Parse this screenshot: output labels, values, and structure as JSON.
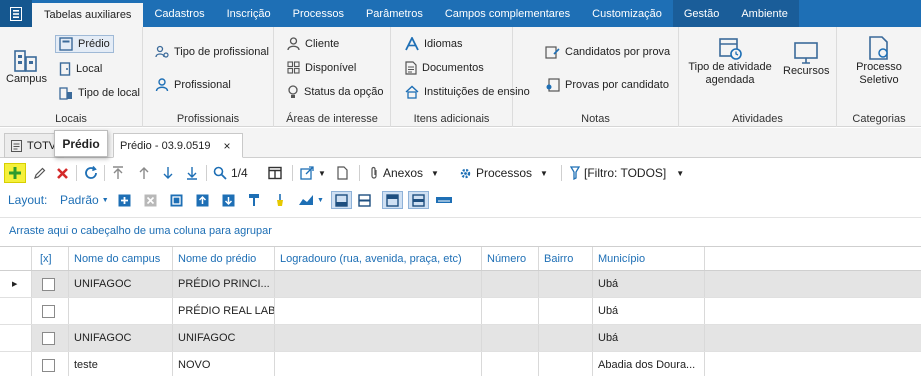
{
  "tabs": {
    "items": [
      "Tabelas auxiliares",
      "Cadastros",
      "Inscrição",
      "Processos",
      "Parâmetros",
      "Campos complementares",
      "Customização",
      "Gestão",
      "Ambiente"
    ]
  },
  "ribbon": {
    "locais": {
      "label": "Locais",
      "campus": "Campus",
      "predio": "Prédio",
      "local": "Local",
      "tipo_local": "Tipo de local"
    },
    "profissionais": {
      "label": "Profissionais",
      "tipo_profissional": "Tipo de profissional",
      "profissional": "Profissional"
    },
    "areas": {
      "label": "Áreas de interesse",
      "cliente": "Cliente",
      "disponivel": "Disponível",
      "status_opcao": "Status da opção"
    },
    "itens": {
      "label": "Itens adicionais",
      "idiomas": "Idiomas",
      "documentos": "Documentos",
      "instituicoes": "Instituições de ensino"
    },
    "notas": {
      "label": "Notas",
      "candidatos_prova": "Candidatos por prova",
      "provas_candidato": "Provas por candidato"
    },
    "atividades": {
      "label": "Atividades",
      "tipo_atividade": "Tipo de atividade agendada",
      "recursos": "Recursos"
    },
    "categorias": {
      "label": "Categorias",
      "processo_seletivo": "Processo Seletivo"
    }
  },
  "doctabs": {
    "first": "TOTV",
    "active": "Prédio - 03.9.0519",
    "close": "×",
    "tooltip": "Prédio"
  },
  "toolbar": {
    "page": "1/4",
    "anexos": "Anexos",
    "processos": "Processos",
    "filtro": "[Filtro: TODOS]"
  },
  "layout": {
    "label": "Layout:",
    "value": "Padrão"
  },
  "grouping_hint": "Arraste aqui o cabeçalho de uma coluna para agrupar",
  "grid": {
    "columns": [
      "[x]",
      "Nome do campus",
      "Nome do prédio",
      "Logradouro (rua, avenida, praça, etc)",
      "Número",
      "Bairro",
      "Município"
    ],
    "rows": [
      {
        "campus": "UNIFAGOC",
        "predio": "PRÉDIO PRINCI...",
        "logradouro": "",
        "numero": "",
        "bairro": "",
        "municipio": "Ubá"
      },
      {
        "campus": "",
        "predio": "PRÉDIO REAL LAB",
        "logradouro": "",
        "numero": "",
        "bairro": "",
        "municipio": "Ubá"
      },
      {
        "campus": "UNIFAGOC",
        "predio": "UNIFAGOC",
        "logradouro": "",
        "numero": "",
        "bairro": "",
        "municipio": "Ubá"
      },
      {
        "campus": "teste",
        "predio": "NOVO",
        "logradouro": "",
        "numero": "",
        "bairro": "",
        "municipio": "Abadia dos Doura..."
      }
    ]
  },
  "colors": {
    "accent": "#1e6fb5",
    "ribbon_bg": "#f4f4f4",
    "highlight": "#f5f03a",
    "add_green": "#2e9b2e",
    "delete_red": "#d42a2a"
  }
}
